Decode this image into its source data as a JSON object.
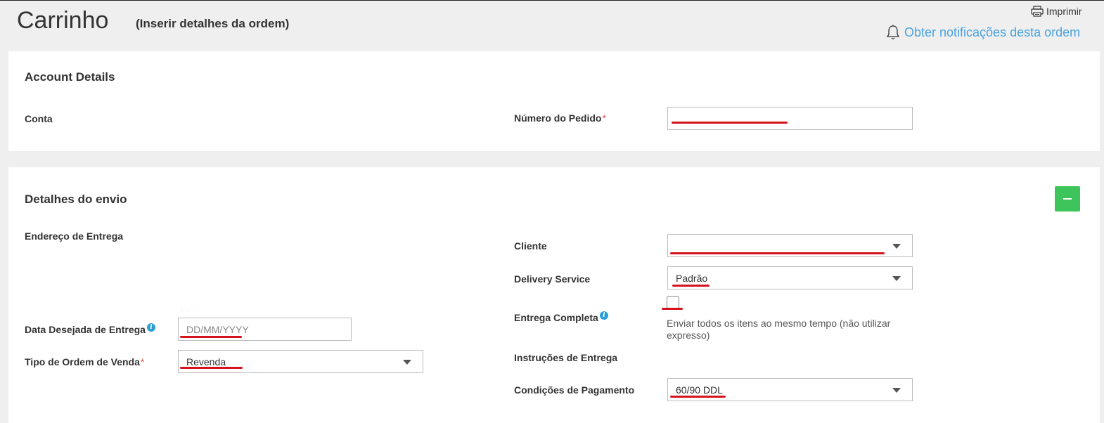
{
  "header": {
    "title": "Carrinho",
    "subtitle": "(Inserir detalhes da ordem)",
    "print_label": "Imprimir",
    "notify_label": "Obter notificações desta ordem",
    "notify_color": "#4aa3df"
  },
  "account_details": {
    "title": "Account Details",
    "account_label": "Conta",
    "order_number_label": "Número do Pedido",
    "order_number_value": ""
  },
  "shipping": {
    "title": "Detalhes do envio",
    "collapse_icon": "minus-icon",
    "collapse_color": "#3dc45b",
    "delivery_address_label": "Endereço de Entrega",
    "desired_date_label": "Data Desejada de Entrega",
    "desired_date_placeholder": "DD/MM/YYYY",
    "order_type_label": "Tipo de Ordem de Venda",
    "order_type_value": "Revenda",
    "client_label": "Cliente",
    "client_value": "",
    "delivery_service_label": "Delivery Service",
    "delivery_service_value": "Padrão",
    "complete_delivery_label": "Entrega Completa",
    "complete_delivery_checked": false,
    "complete_delivery_help": "Enviar todos os itens ao mesmo tempo (não utilizar expresso)",
    "delivery_instructions_label": "Instruções de Entrega",
    "payment_terms_label": "Condições de Pagamento",
    "payment_terms_value": "60/90 DDL"
  },
  "annotation_color": "#d4141c",
  "required_marker": "*",
  "info_marker": "i"
}
